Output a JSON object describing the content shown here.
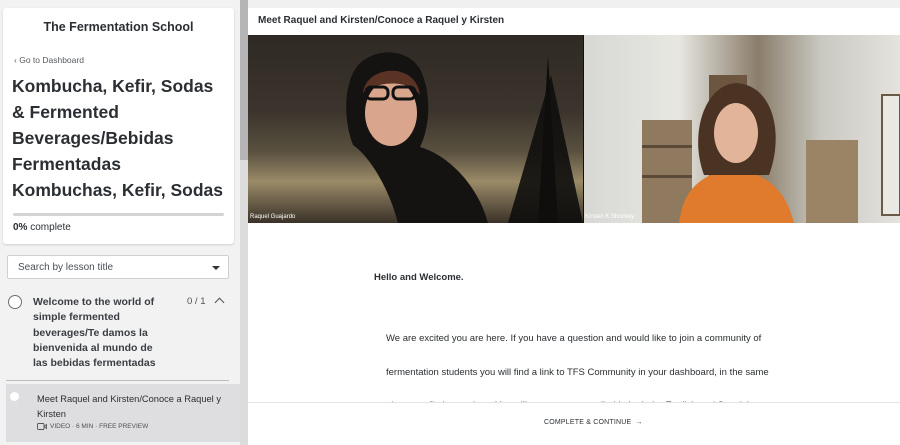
{
  "sidebar": {
    "school_name": "The Fermentation School",
    "back_link": "Go to Dashboard",
    "course_title": "Kombucha, Kefir, Sodas & Fermented Beverages/Bebidas Fermentadas Kombuchas, Kefir, Sodas",
    "progress_percent": "0%",
    "progress_label": "complete",
    "progress_value": 0,
    "search_placeholder": "Search by lesson title",
    "chapter": {
      "title": "Welcome to the world of simple fermented beverages/Te damos la bienvenida al mundo de las bebidas fermentadas",
      "count": "0 / 1"
    },
    "lesson": {
      "title": "Meet Raquel and Kirsten/Conoce a Raquel y Kirsten",
      "meta": "VIDEO · 6 MIN · FREE PREVIEW"
    }
  },
  "main": {
    "lesson_header": "Meet Raquel and Kirsten/Conoce a Raquel y Kirsten",
    "video": {
      "left_name": "Raquel Guajardo",
      "right_name": "Kirsten K Shockey"
    },
    "greeting": "Hello and Welcome.",
    "paragraph_lines": [
      "We are excited you are here. If you have a question and would like to join a community of",
      "fermentation students you will find a link to TFS Community in your dashboard, in the same",
      "place you find your class. You will see you are enrolled in both the English and Spanish"
    ],
    "complete_button": "COMPLETE & CONTINUE"
  },
  "colors": {
    "background": "#f0f0f1",
    "text": "#2b2f33",
    "active_lesson": "#dedee0"
  }
}
